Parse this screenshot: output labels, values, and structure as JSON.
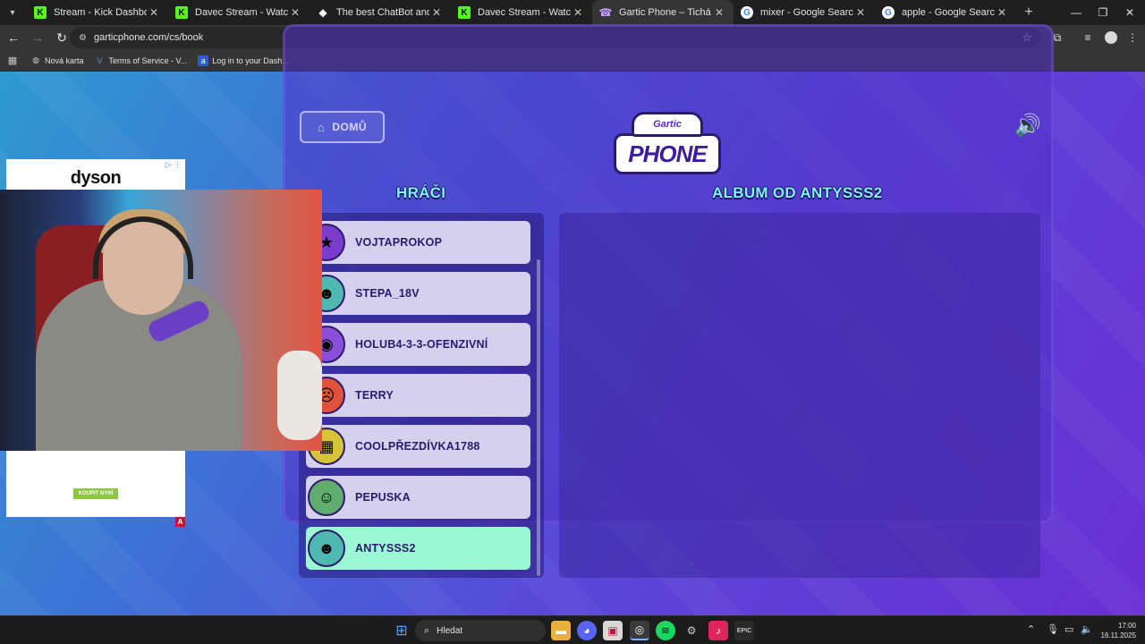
{
  "browser": {
    "tabs": [
      {
        "title": "Stream - Kick Dashboard",
        "favicon": "kick-icon",
        "active": false
      },
      {
        "title": "Davec Stream - Watch Live on Kick",
        "favicon": "kick-icon",
        "active": false
      },
      {
        "title": "The best ChatBot and Widgets",
        "favicon": "diamond-icon",
        "active": false
      },
      {
        "title": "Davec Stream - Watch Live on Kick",
        "favicon": "kick-icon",
        "active": false
      },
      {
        "title": "Gartic Phone – Tichá pošta",
        "favicon": "gartic-icon",
        "active": true
      },
      {
        "title": "mixer - Google Search",
        "favicon": "google-icon",
        "active": false
      },
      {
        "title": "apple - Google Search",
        "favicon": "google-icon",
        "active": false
      }
    ],
    "url": "garticphone.com/cs/book",
    "bookmarks": [
      {
        "label": "Nová karta"
      },
      {
        "label": "Terms of Service - V..."
      },
      {
        "label": "Log in to your Dash..."
      }
    ]
  },
  "game": {
    "home_label": "DOMŮ",
    "logo_top": "Gartic",
    "logo_bottom": "PHONE",
    "players_heading": "HRÁČI",
    "album_heading": "ALBUM OD ANTYSSS2",
    "players": [
      {
        "name": "VOJTAPROKOP",
        "active": false
      },
      {
        "name": "STEPA_18V",
        "active": false
      },
      {
        "name": "HOLUB4-3-3-OFENZIVNÍ",
        "active": false
      },
      {
        "name": "TERRY",
        "active": false
      },
      {
        "name": "COOLPŘEZDÍVKA1788",
        "active": false
      },
      {
        "name": "PEPUSKA",
        "active": false
      },
      {
        "name": "ANTYSSS2",
        "active": true
      }
    ]
  },
  "overlay": {
    "ad_brand": "dyson",
    "ad_button": "KOUPIT NYNÍ",
    "ad_badge": "A"
  },
  "taskbar": {
    "search_label": "Hledat",
    "time": "17:00",
    "date": "16.11.2025"
  },
  "colors": {
    "active_player": "#9cf7d5",
    "player": "#d4d0ee",
    "heading": "#7ef5ff"
  }
}
